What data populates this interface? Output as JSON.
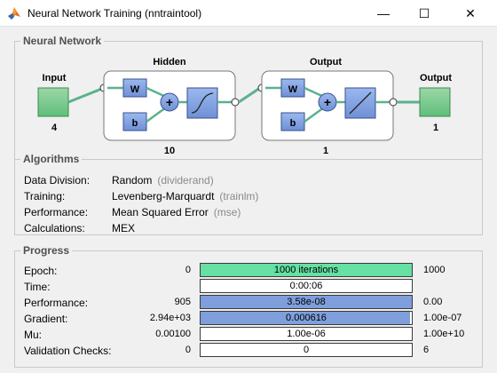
{
  "window": {
    "title": "Neural Network Training (nntraintool)",
    "icon": "matlab-icon",
    "minimize_glyph": "—",
    "maximize_glyph": "☐",
    "close_glyph": "✕"
  },
  "network": {
    "section_label": "Neural Network",
    "input_label": "Input",
    "input_size": "4",
    "hidden_label": "Hidden",
    "hidden_size": "10",
    "output_layer_label": "Output",
    "output_layer_size": "1",
    "output_label": "Output",
    "output_size": "1",
    "weight_symbol": "W",
    "bias_symbol": "b",
    "sum_symbol": "+"
  },
  "algorithms": {
    "section_label": "Algorithms",
    "rows": [
      {
        "key": "Data Division:",
        "value": "Random",
        "paren": "(dividerand)"
      },
      {
        "key": "Training:",
        "value": "Levenberg-Marquardt",
        "paren": "(trainlm)"
      },
      {
        "key": "Performance:",
        "value": "Mean Squared Error",
        "paren": "(mse)"
      },
      {
        "key": "Calculations:",
        "value": "MEX",
        "paren": ""
      }
    ]
  },
  "progress": {
    "section_label": "Progress",
    "rows": [
      {
        "label": "Epoch:",
        "start": "0",
        "bar_text": "1000 iterations",
        "end": "1000",
        "fill_fraction": 1.0,
        "fill_color": "#66e0a3"
      },
      {
        "label": "Time:",
        "start": "",
        "bar_text": "0:00:06",
        "end": "",
        "fill_fraction": 0.0,
        "fill_color": "#ffffff"
      },
      {
        "label": "Performance:",
        "start": "905",
        "bar_text": "3.58e-08",
        "end": "0.00",
        "fill_fraction": 1.0,
        "fill_color": "#7f9fdc"
      },
      {
        "label": "Gradient:",
        "start": "2.94e+03",
        "bar_text": "0.000616",
        "end": "1.00e-07",
        "fill_fraction": 0.99,
        "fill_color": "#7f9fdc"
      },
      {
        "label": "Mu:",
        "start": "0.00100",
        "bar_text": "1.00e-06",
        "end": "1.00e+10",
        "fill_fraction": 0.0,
        "fill_color": "#7f9fdc"
      },
      {
        "label": "Validation Checks:",
        "start": "0",
        "bar_text": "0",
        "end": "6",
        "fill_fraction": 0.0,
        "fill_color": "#7f9fdc"
      }
    ]
  }
}
